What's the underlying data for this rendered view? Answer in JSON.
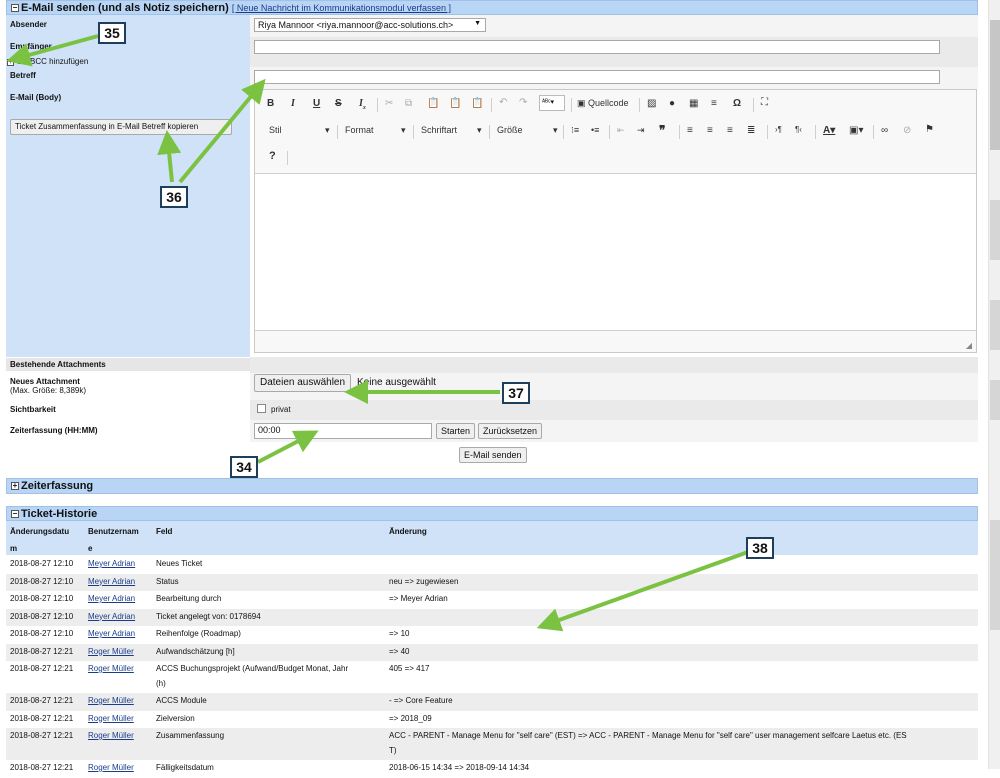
{
  "email_section": {
    "title": "E-Mail senden (und als Notiz speichern)",
    "link": "[ Neue Nachricht im Kommunikationsmodul verfassen ]",
    "labels": {
      "absender": "Absender",
      "empfaenger": "Empfänger",
      "ccbcc": "CC/BCC hinzufügen",
      "betreff": "Betreff",
      "body": "E-Mail (Body)",
      "attachments": "Bestehende Attachments",
      "new_attachment": "Neues Attachment",
      "max_size": "(Max. Größe: 8,389k)",
      "sichtbarkeit": "Sichtbarkeit",
      "zeiterfassung": "Zeiterfassung (HH:MM)"
    },
    "absender_value": "Riya Mannoor <riya.mannoor@acc-solutions.ch>",
    "copy_button": "Ticket Zusammenfassung in E-Mail Betreff kopieren",
    "file_button": "Dateien auswählen",
    "file_status": "Keine ausgewählt",
    "privat_label": "privat",
    "time_value": "00:00",
    "start_button": "Starten",
    "reset_button": "Zurücksetzen",
    "send_button": "E-Mail senden"
  },
  "editor": {
    "source_label": "Quellcode",
    "stil": "Stil",
    "format": "Format",
    "schriftart": "Schriftart",
    "groesse": "Größe",
    "help": "?"
  },
  "zeiterfassung_section": {
    "title": "Zeiterfassung"
  },
  "history_section": {
    "title": "Ticket-Historie",
    "headers": {
      "date_line1": "Änderungsdatu",
      "date_line2": "m",
      "user_line1": "Benutzernam",
      "user_line2": "e",
      "field": "Feld",
      "change": "Änderung"
    },
    "rows": [
      {
        "date": "2018-08-27 12:10",
        "user": "Meyer Adrian",
        "field": "Neues Ticket",
        "change": ""
      },
      {
        "date": "2018-08-27 12:10",
        "user": "Meyer Adrian",
        "field": "Status",
        "change": "neu => zugewiesen"
      },
      {
        "date": "2018-08-27 12:10",
        "user": "Meyer Adrian",
        "field": "Bearbeitung durch",
        "change": "=> Meyer Adrian"
      },
      {
        "date": "2018-08-27 12:10",
        "user": "Meyer Adrian",
        "field": "Ticket angelegt von: 0178694",
        "change": ""
      },
      {
        "date": "2018-08-27 12:10",
        "user": "Meyer Adrian",
        "field": "Reihenfolge (Roadmap)",
        "change": "=> 10"
      },
      {
        "date": "2018-08-27 12:21",
        "user": "Roger Müller",
        "field": "Aufwandschätzung [h]",
        "change": "=> 40"
      },
      {
        "date": "2018-08-27 12:21",
        "user": "Roger Müller",
        "field": "ACCS Buchungsprojekt (Aufwand/Budget Monat, Jahr",
        "field2": "(h)",
        "change": "405 => 417"
      },
      {
        "date": "2018-08-27 12:21",
        "user": "Roger Müller",
        "field": "ACCS Module",
        "change": "- => Core Feature"
      },
      {
        "date": "2018-08-27 12:21",
        "user": "Roger Müller",
        "field": "Zielversion",
        "change": "=> 2018_09"
      },
      {
        "date": "2018-08-27 12:21",
        "user": "Roger Müller",
        "field": "Zusammenfassung",
        "change": "ACC - PARENT - Manage Menu for \"self care\" (EST) => ACC - PARENT - Manage Menu for \"self care\" user management selfcare Laetus etc. (ES",
        "change2": "T)"
      },
      {
        "date": "2018-08-27 12:21",
        "user": "Roger Müller",
        "field": "Fälligkeitsdatum",
        "change": "2018-06-15 14:34 => 2018-09-14 14:34"
      }
    ]
  },
  "markers": {
    "m34": "34",
    "m35": "35",
    "m36": "36",
    "m37": "37",
    "m38": "38"
  },
  "colors": {
    "arrow": "#7cc242",
    "header_bg": "#b9d5f5",
    "label_bg": "#cfe2f8"
  }
}
